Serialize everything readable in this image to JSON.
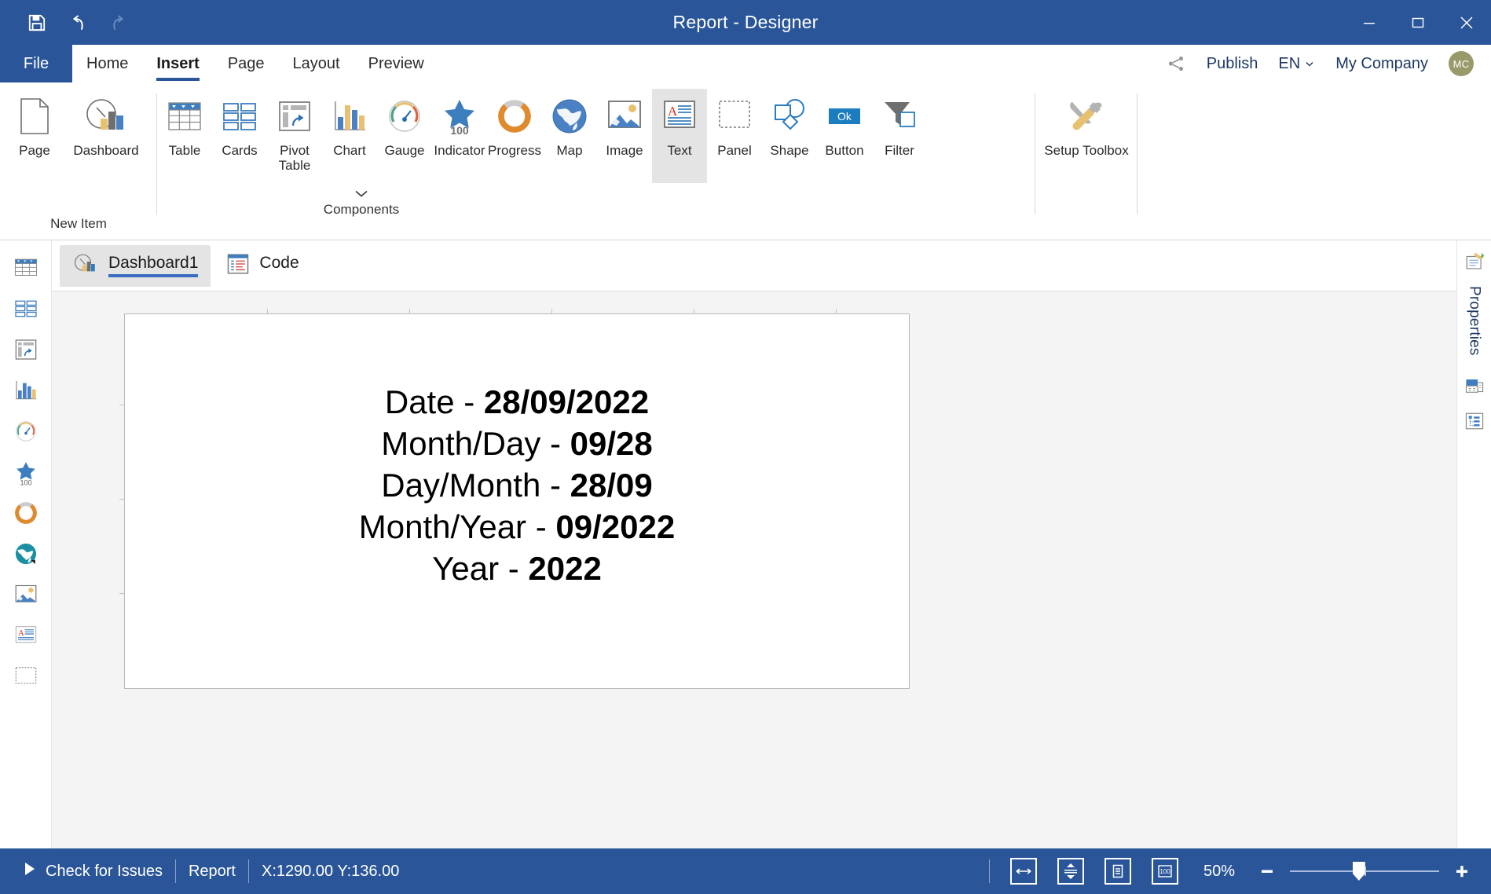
{
  "window": {
    "title": "Report - Designer",
    "quick_access": [
      {
        "name": "save-button",
        "label": "Save"
      },
      {
        "name": "undo-button",
        "label": "Undo"
      },
      {
        "name": "redo-button",
        "label": "Redo"
      }
    ],
    "controls": [
      {
        "name": "minimize-button",
        "label": "Minimize"
      },
      {
        "name": "maximize-button",
        "label": "Maximize"
      },
      {
        "name": "close-button",
        "label": "Close"
      }
    ]
  },
  "menu": {
    "file_label": "File",
    "tabs": [
      {
        "label": "Home",
        "active": false
      },
      {
        "label": "Insert",
        "active": true
      },
      {
        "label": "Page",
        "active": false
      },
      {
        "label": "Layout",
        "active": false
      },
      {
        "label": "Preview",
        "active": false
      }
    ],
    "share_label": "share-icon",
    "publish_label": "Publish",
    "language": "EN",
    "company": "My Company",
    "avatar_initials": "MC"
  },
  "ribbon": {
    "groups": [
      {
        "label": "New Item",
        "items": [
          {
            "label": "Page",
            "icon": "page-icon"
          },
          {
            "label": "Dashboard",
            "icon": "dashboard-icon"
          }
        ]
      },
      {
        "label": "Components",
        "items": [
          {
            "label": "Table",
            "icon": "table-icon"
          },
          {
            "label": "Cards",
            "icon": "cards-icon"
          },
          {
            "label": "Pivot Table",
            "icon": "pivot-table-icon"
          },
          {
            "label": "Chart",
            "icon": "chart-icon"
          },
          {
            "label": "Gauge",
            "icon": "gauge-icon"
          },
          {
            "label": "Indicator",
            "icon": "indicator-icon"
          },
          {
            "label": "Progress",
            "icon": "progress-icon"
          },
          {
            "label": "Map",
            "icon": "map-icon"
          },
          {
            "label": "Image",
            "icon": "image-icon"
          },
          {
            "label": "Text",
            "icon": "text-icon"
          },
          {
            "label": "Panel",
            "icon": "panel-icon"
          },
          {
            "label": "Shape",
            "icon": "shape-icon"
          },
          {
            "label": "Button",
            "icon": "button-icon"
          },
          {
            "label": "Filter",
            "icon": "filter-icon"
          }
        ]
      },
      {
        "label": "",
        "items": [
          {
            "label": "Setup Toolbox",
            "icon": "setup-toolbox-icon"
          }
        ]
      }
    ],
    "selected_item": "Text"
  },
  "left_toolbox": {
    "items": [
      {
        "name": "table-icon",
        "label": "Table"
      },
      {
        "name": "cards-icon",
        "label": "Cards"
      },
      {
        "name": "pivot-table-icon",
        "label": "Pivot Table"
      },
      {
        "name": "chart-icon",
        "label": "Chart"
      },
      {
        "name": "gauge-icon",
        "label": "Gauge"
      },
      {
        "name": "indicator-icon",
        "label": "Indicator"
      },
      {
        "name": "progress-icon",
        "label": "Progress"
      },
      {
        "name": "map-icon",
        "label": "Map"
      },
      {
        "name": "image-icon",
        "label": "Image"
      },
      {
        "name": "text-icon",
        "label": "Text"
      },
      {
        "name": "panel-icon",
        "label": "Panel"
      }
    ],
    "indicator_value": "100"
  },
  "doc_tabs": [
    {
      "label": "Dashboard1",
      "icon": "dashboard-icon",
      "active": true
    },
    {
      "label": "Code",
      "icon": "code-icon",
      "active": false
    }
  ],
  "canvas": {
    "rows": [
      {
        "label": "Date - ",
        "value": "28/09/2022"
      },
      {
        "label": "Month/Day - ",
        "value": "09/28"
      },
      {
        "label": "Day/Month - ",
        "value": "28/09"
      },
      {
        "label": "Month/Year - ",
        "value": "09/2022"
      },
      {
        "label": "Year - ",
        "value": "2022"
      }
    ]
  },
  "right_panel": {
    "properties_label": "Properties",
    "items": [
      {
        "name": "properties-icon"
      },
      {
        "name": "dictionary-icon"
      },
      {
        "name": "report-tree-icon"
      }
    ]
  },
  "status": {
    "check_for_issues": "Check for Issues",
    "report": "Report",
    "coordinates": "X:1290.00 Y:136.00",
    "zoom": "50%",
    "view_buttons": [
      {
        "name": "fit-width-button"
      },
      {
        "name": "fit-page-button"
      },
      {
        "name": "single-page-button"
      },
      {
        "name": "actual-size-button"
      }
    ],
    "zoom_out_label": "−",
    "zoom_in_label": "+"
  },
  "colors": {
    "accent": "#2a5699",
    "tab_underline": "#3a6cbf",
    "avatar": "#989a6a",
    "orange": "#e08a2e",
    "teal": "#1b8fa3",
    "sand": "#e8c170"
  }
}
